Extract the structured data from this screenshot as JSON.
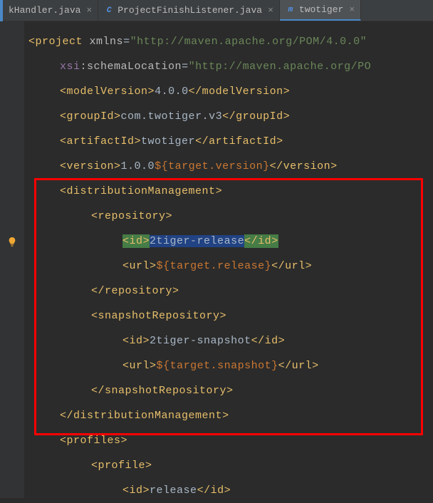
{
  "tabs": [
    {
      "label": "kHandler.java",
      "icon": "C"
    },
    {
      "label": "ProjectFinishListener.java",
      "icon": "C"
    },
    {
      "label": "twotiger",
      "icon": "m"
    }
  ],
  "xml": {
    "project": "project",
    "xmlns": "xmlns",
    "xmlns_url": "http://maven.apache.org/POM/4.0.0",
    "xsi": "xsi",
    "schemaLocation": "schemaLocation",
    "schemaLocation_url": "http://maven.apache.org/PO",
    "modelVersion_tag": "modelVersion",
    "modelVersion_val": "4.0.0",
    "groupId_tag": "groupId",
    "groupId_val": "com.twotiger.v3",
    "artifactId_tag": "artifactId",
    "artifactId_val": "twotiger",
    "version_tag": "version",
    "version_val": "1.0.0",
    "target_version": "target.version",
    "distMgmt_tag": "distributionManagement",
    "repository_tag": "repository",
    "id_tag": "id",
    "release_id": "2tiger-release",
    "url_tag": "url",
    "target_release": "target.release",
    "snapshotRepo_tag": "snapshotRepository",
    "snapshot_id": "2tiger-snapshot",
    "target_snapshot": "target.snapshot",
    "profiles_tag": "profiles",
    "profile_tag": "profile",
    "release_val": "release"
  }
}
